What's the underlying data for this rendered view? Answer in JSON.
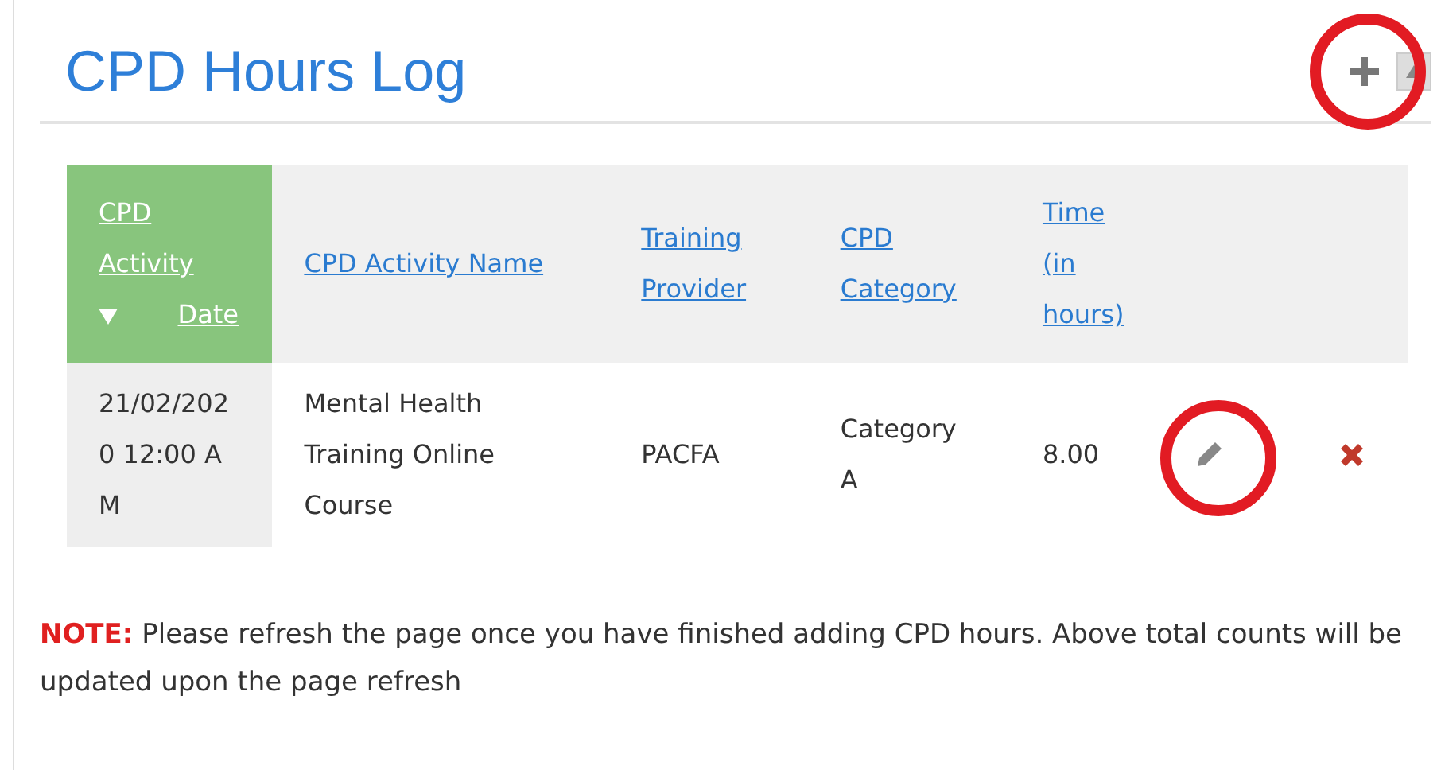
{
  "panel": {
    "title": "CPD Hours Log"
  },
  "table": {
    "columns": [
      {
        "label": "CPD Activity Date",
        "selected": true
      },
      {
        "label": "CPD Activity Name",
        "selected": false
      },
      {
        "label": "Training Provider",
        "selected": false
      },
      {
        "label": "CPD Category",
        "selected": false
      },
      {
        "label": "Time (in hours)",
        "selected": false
      }
    ],
    "rows": [
      {
        "cells": [
          "21/02/2020 12:00 AM",
          "Mental Health Training Online Course",
          "PACFA",
          "Category A",
          "8.00"
        ]
      }
    ]
  },
  "note": {
    "label": "NOTE:",
    "text": "Please refresh the page once you have finished adding CPD hours. Above total counts will be updated upon the page refresh"
  }
}
